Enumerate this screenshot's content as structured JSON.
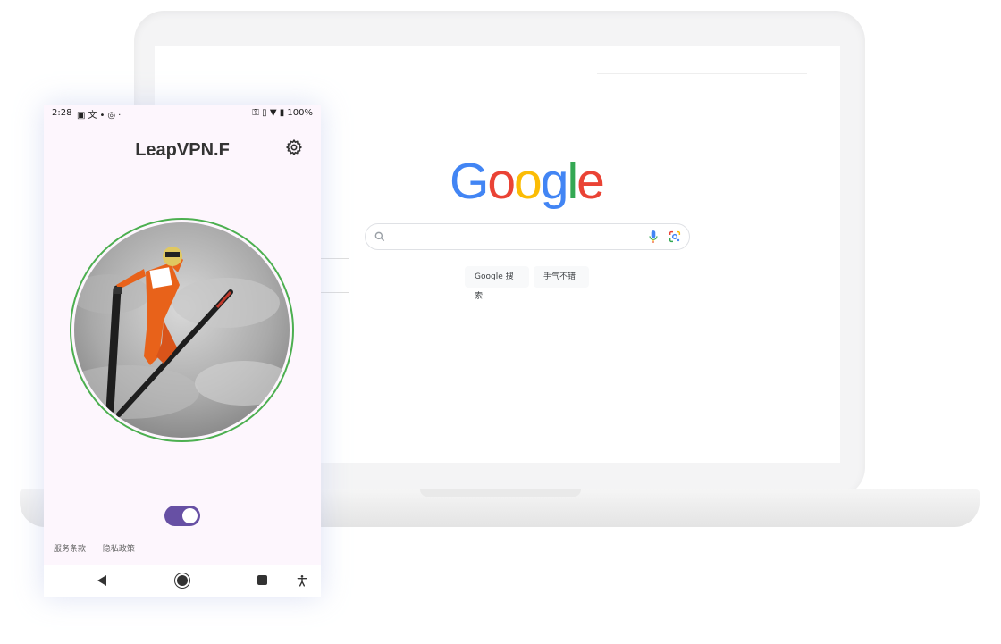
{
  "browser": {
    "logo": {
      "letters": [
        {
          "char": "G",
          "color": "#4285F4"
        },
        {
          "char": "o",
          "color": "#EA4335"
        },
        {
          "char": "o",
          "color": "#FBBC05"
        },
        {
          "char": "g",
          "color": "#4285F4"
        },
        {
          "char": "l",
          "color": "#34A853"
        },
        {
          "char": "e",
          "color": "#EA4335"
        }
      ]
    },
    "search": {
      "value": "",
      "placeholder": ""
    },
    "buttons": {
      "search_label": "Google 搜索",
      "lucky_label": "手气不错"
    }
  },
  "phone": {
    "status": {
      "time": "2:28",
      "left_icons": [
        "image-icon",
        "translate-icon",
        "location-icon",
        "vpn-icon",
        "dot-icon"
      ],
      "right_icons": [
        "vpn-key-icon",
        "vibrate-icon",
        "wifi-icon",
        "battery-icon"
      ],
      "battery": "100%"
    },
    "app_title": "LeapVPN.F",
    "toggle": {
      "on": true,
      "color": "#6750a4"
    },
    "ring_color": "#4caf50",
    "footer": {
      "terms": "服务条款",
      "privacy": "隐私政策"
    },
    "nav": [
      "back-icon",
      "home-icon",
      "recents-icon",
      "accessibility-icon"
    ]
  }
}
